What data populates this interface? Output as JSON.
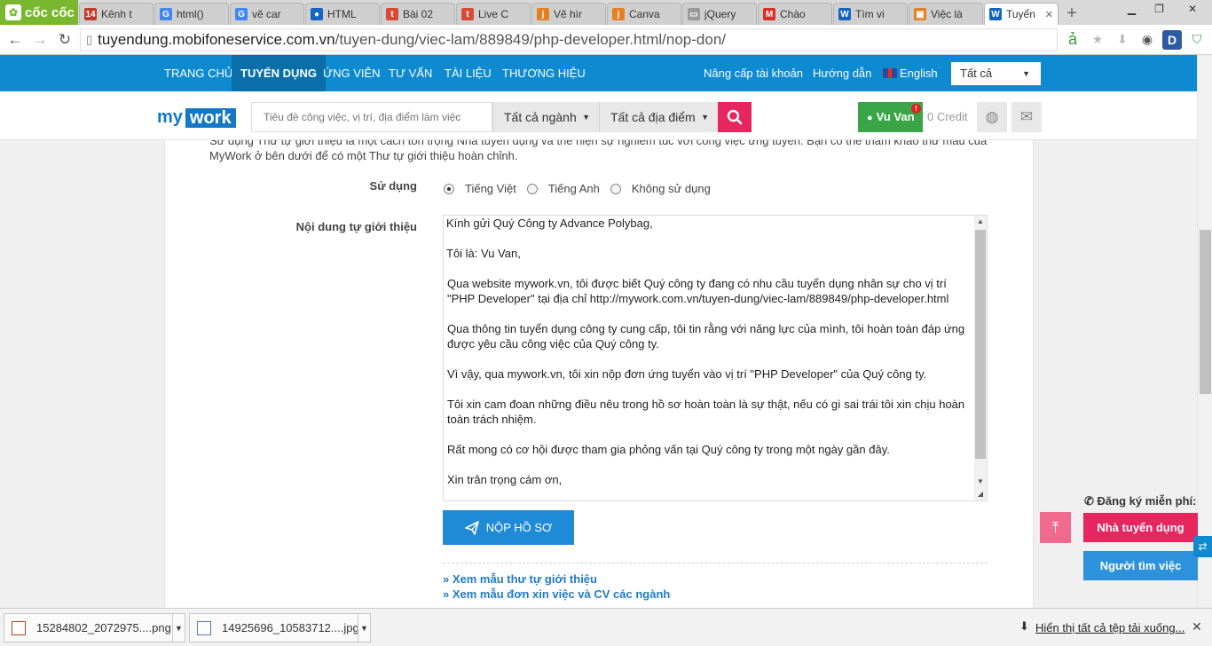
{
  "browser": {
    "brand": "cốc cốc",
    "tabs": [
      {
        "label": "Kênh t",
        "fav": "14",
        "color": "#c0392b"
      },
      {
        "label": "html()",
        "fav": "G",
        "color": "#4285f4"
      },
      {
        "label": "vẽ car",
        "fav": "G",
        "color": "#4285f4"
      },
      {
        "label": "HTML",
        "fav": "●",
        "color": "#1565c0"
      },
      {
        "label": "Bài 02",
        "fav": "t",
        "color": "#d94a38"
      },
      {
        "label": "Live C",
        "fav": "t",
        "color": "#d94a38"
      },
      {
        "label": "Vẽ hìr",
        "fav": "j",
        "color": "#e67e22"
      },
      {
        "label": "Canva",
        "fav": "j",
        "color": "#e67e22"
      },
      {
        "label": "jQuery",
        "fav": "▭",
        "color": "#999999"
      },
      {
        "label": "Chào",
        "fav": "M",
        "color": "#d93025"
      },
      {
        "label": "Tìm vi",
        "fav": "W",
        "color": "#1565c0"
      },
      {
        "label": "Việc là",
        "fav": "▣",
        "color": "#e67e22"
      },
      {
        "label": "Tuyển",
        "fav": "W",
        "color": "#1565c0"
      }
    ],
    "url_host": "tuyendung.mobifoneservice.com.vn",
    "url_path": "/tuyen-dung/viec-lam/889849/php-developer.html/nop-don/"
  },
  "nav": {
    "items": [
      "TRANG CHỦ",
      "TUYỂN DỤNG",
      "ỨNG VIÊN",
      "TƯ VẤN",
      "TÀI LIỆU",
      "THƯƠNG HIỆU"
    ],
    "upgrade": "Nâng cấp tài khoản",
    "guide": "Hướng dẫn",
    "language": "English",
    "select": "Tất cả"
  },
  "search": {
    "logo_my": "my",
    "logo_work": "work",
    "placeholder": "Tiêu đề công việc, vị trí, địa điểm làm việc",
    "industry": "Tất cả ngành",
    "location": "Tất cả địa điểm",
    "user": "Vu Van",
    "user_badge": "!",
    "credit": "0 Credit"
  },
  "content": {
    "intro": "Sử dụng Thư tự giới thiệu là một cách tôn trọng Nhà tuyển dụng và thể hiện sự nghiêm túc với công việc ứng tuyển. Bạn có thể tham khảo thư mẫu của MyWork ở bên dưới để có một Thư tự giới thiệu hoàn chỉnh.",
    "use_label": "Sử dụng",
    "options": [
      "Tiếng Việt",
      "Tiếng Anh",
      "Không sử dụng"
    ],
    "selected_option": "Tiếng Việt",
    "letter_label": "Nội dung tự giới thiệu",
    "letter": [
      "Kính gửi Quý Công ty Advance Polybag,",
      "Tôi là: Vu Van,",
      "Qua website mywork.vn, tôi được biết Quý công ty đang có nhu cầu tuyển dụng nhân sự cho vị trí \"PHP Developer\" tại địa chỉ http://mywork.com.vn/tuyen-dung/viec-lam/889849/php-developer.html",
      "Qua thông tin tuyển dụng công ty cung cấp, tôi tin rằng với năng lực của mình, tôi hoàn toàn đáp ứng được yêu cầu công việc của Quý công ty.",
      "Vì vậy, qua mywork.vn, tôi xin nộp đơn ứng tuyển vào vị trí \"PHP Developer\" của Quý công ty.",
      "Tôi xin cam đoan những điều nêu trong hồ sơ hoàn toàn là sự thật, nếu có gì sai trái tôi xin chịu hoàn toàn trách nhiệm.",
      "Rất mong có cơ hội được tham gia phỏng vấn tại Quý công ty trong một ngày gần đây.",
      "Xin trân trọng cám ơn,"
    ],
    "submit": "NỘP HỒ SƠ",
    "link1": "» Xem mẫu thư tự giới thiệu",
    "link2": "» Xem mẫu đơn xin việc và CV các ngành"
  },
  "widgets": {
    "register": "Đăng ký miễn phí:",
    "employer": "Nhà tuyển dụng",
    "seeker": "Người tìm việc"
  },
  "downloads": {
    "files": [
      "15284802_2072975....png",
      "14925696_10583712....jpg"
    ],
    "show_all": "Hiển thị tất cả tệp tải xuống..."
  },
  "colors": {
    "nav_blue": "#0e8ad0",
    "accent_pink": "#e6265f",
    "user_green": "#3aa546",
    "brand_green": "#79b82e"
  }
}
